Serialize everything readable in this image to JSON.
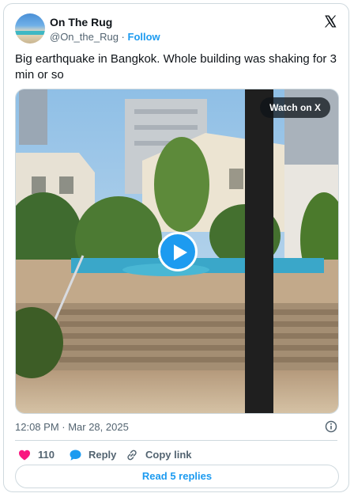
{
  "author": {
    "name": "On The Rug",
    "handle": "@On_the_Rug",
    "separator": "·",
    "follow_label": "Follow"
  },
  "tweet": {
    "text": "Big earthquake in Bangkok. Whole building was shaking for 3 min or so",
    "timestamp": "12:08 PM · Mar 28, 2025"
  },
  "media": {
    "watch_label": "Watch on X"
  },
  "actions": {
    "like_count": "110",
    "reply_label": "Reply",
    "copy_link_label": "Copy link"
  },
  "replies_button_label": "Read 5 replies",
  "colors": {
    "accent": "#1d9bf0",
    "like": "#f91880",
    "text": "#0f1419",
    "muted": "#536471",
    "border": "#cfd9de"
  },
  "icons": [
    "x-logo-icon",
    "play-icon",
    "info-icon",
    "heart-icon",
    "reply-bubble-icon",
    "link-icon"
  ]
}
